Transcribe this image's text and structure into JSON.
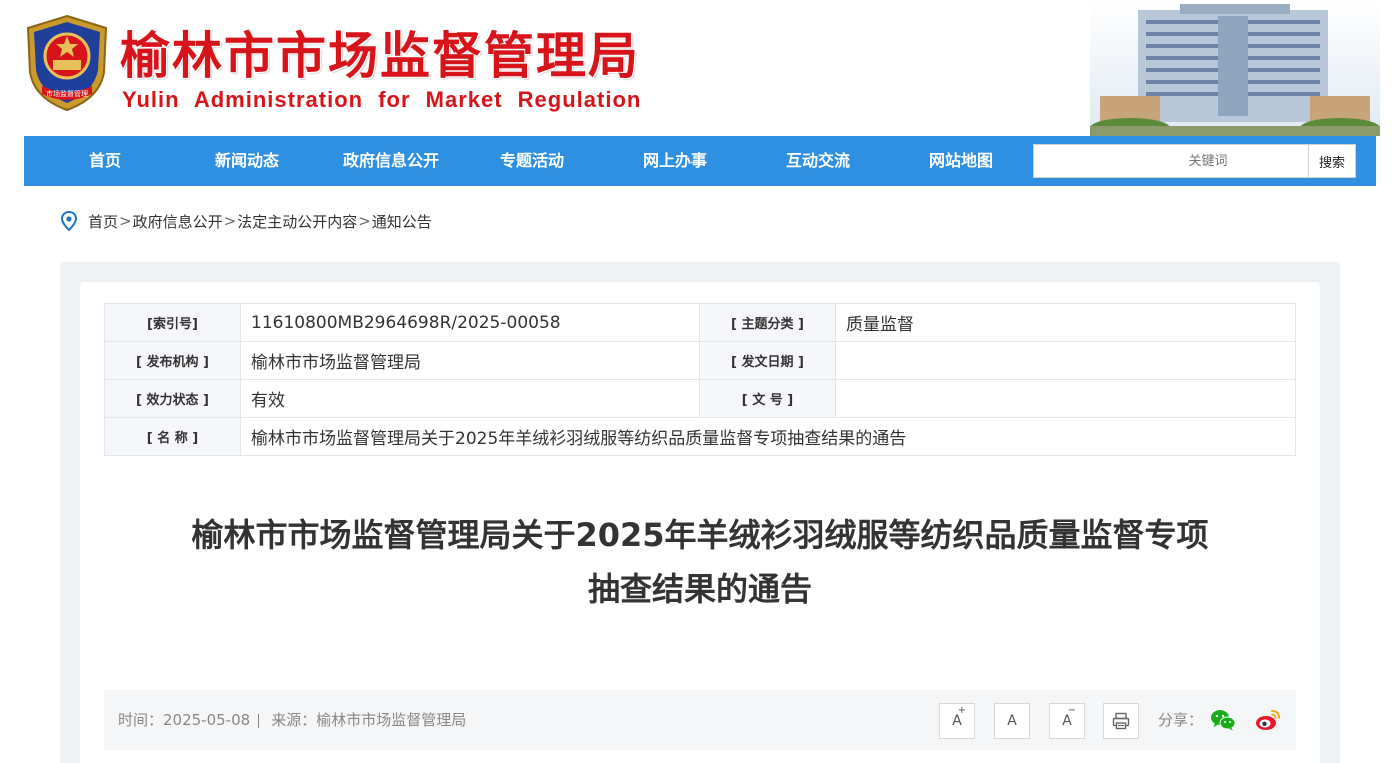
{
  "header": {
    "title_cn": "榆林市市场监督管理局",
    "title_en": "Yulin Administration for Market Regulation",
    "emblem_text": "市场监督管理"
  },
  "nav": {
    "items": [
      "首页",
      "新闻动态",
      "政府信息公开",
      "专题活动",
      "网上办事",
      "互动交流",
      "网站地图"
    ],
    "search_placeholder": "关键词",
    "search_button": "搜索"
  },
  "breadcrumb": {
    "items": [
      "首页",
      "政府信息公开",
      "法定主动公开内容",
      "通知公告"
    ],
    "separator": ">"
  },
  "info": {
    "index_label": "[索引号]",
    "index_value": "11610800MB2964698R/2025-00058",
    "topic_label": "[ 主题分类 ]",
    "topic_value": "质量监督",
    "publisher_label": "[ 发布机构 ]",
    "publisher_value": "榆林市市场监督管理局",
    "date_label": "[ 发文日期 ]",
    "date_value": "",
    "status_label": "[ 效力状态 ]",
    "status_value": "有效",
    "docno_label": "[ 文 号 ]",
    "docno_value": "",
    "name_label": "[ 名 称 ]",
    "name_value": "榆林市市场监督管理局关于2025年羊绒衫羽绒服等纺织品质量监督专项抽查结果的通告"
  },
  "article": {
    "title_line1": "榆林市市场监督管理局关于2025年羊绒衫羽绒服等纺织品质量监督专项",
    "title_line2": "抽查结果的通告"
  },
  "meta": {
    "time_text": "时间：2025-05-08",
    "source_text": "来源：榆林市市场监督管理局",
    "font_increase": "A",
    "font_increase_mark": "+",
    "font_normal": "A",
    "font_decrease": "A",
    "font_decrease_mark": "−",
    "share_label": "分享："
  },
  "colors": {
    "brand_red": "#d7141a",
    "nav_blue": "#2f8fe0",
    "wechat_green": "#1aad19",
    "weibo_red": "#e6162d"
  },
  "icons": [
    "location-pin-icon",
    "print-icon",
    "wechat-icon",
    "weibo-icon"
  ]
}
